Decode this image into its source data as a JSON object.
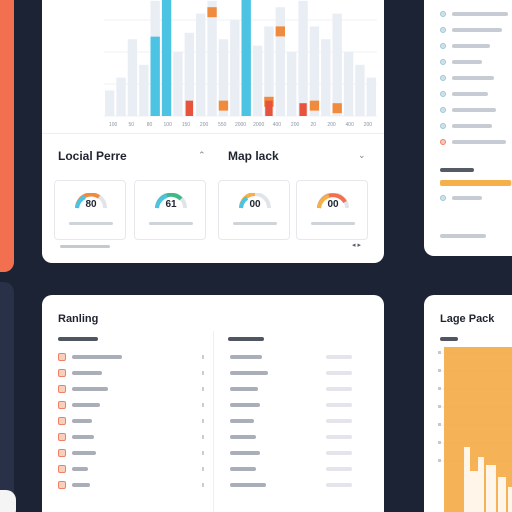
{
  "main_chart": {
    "x_ticks": [
      "100",
      "50",
      "80",
      "100",
      "150",
      "200",
      "550",
      "2000",
      "2000",
      "400",
      "200",
      "20",
      "200",
      "400",
      "200"
    ],
    "series": [
      {
        "name": "",
        "color": "#4cc3e3",
        "values": [
          0,
          0,
          0,
          0,
          0.62,
          0.96,
          0,
          0,
          0,
          0,
          0,
          0,
          0.98,
          0,
          0,
          0,
          0,
          0,
          0,
          0,
          0,
          0,
          0,
          0
        ]
      },
      {
        "name": "",
        "color": "#f08a3c",
        "values": [
          0,
          0,
          0,
          0,
          0,
          0,
          0,
          0,
          0,
          0.85,
          0.12,
          0,
          0,
          0,
          0.15,
          0.7,
          0,
          0,
          0.12,
          0,
          0.1,
          0,
          0,
          0
        ]
      },
      {
        "name": "",
        "color": "#f08a3c",
        "values": [
          0,
          0,
          0,
          0,
          0.12,
          0.96,
          0,
          0,
          0,
          0.85,
          0.15,
          0,
          0,
          0,
          0.15,
          0.75,
          0,
          0,
          0.12,
          0,
          0.1,
          0,
          0,
          0
        ]
      }
    ],
    "accent_colors": {
      "blue": "#4cc3e3",
      "orange": "#f08a3c",
      "red": "#e8533b"
    }
  },
  "panels": {
    "left_title": "Locial Perre",
    "right_title": "Map lack",
    "tiles": [
      {
        "value": "80",
        "icon": "gauge-icon",
        "accent": "#f08a3c"
      },
      {
        "value": "61",
        "icon": "gauge-icon",
        "accent": "#3fb98a"
      },
      {
        "value": "00",
        "icon": "gauge-icon",
        "accent": "#f5b04a"
      },
      {
        "value": "00",
        "icon": "gauge-icon",
        "accent": "#e8533b"
      }
    ],
    "footer_controls": "◂ ▸"
  },
  "side_panel": {
    "progress": 0.98
  },
  "ranking": {
    "title": "Ranling"
  },
  "lage_pack": {
    "title": "Lage Pack",
    "bar_color": "#f5a53a"
  }
}
